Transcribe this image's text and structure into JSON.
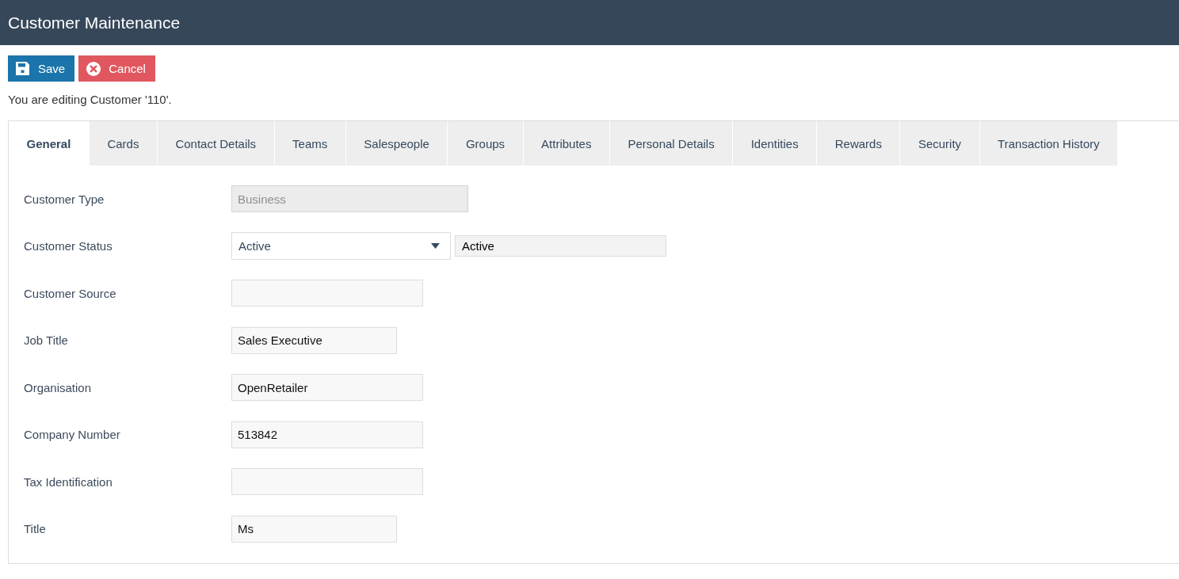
{
  "header": {
    "title": "Customer Maintenance"
  },
  "toolbar": {
    "buttons": [
      {
        "kind": "save",
        "label": "Save"
      },
      {
        "kind": "cancel",
        "label": "Cancel"
      }
    ]
  },
  "status_message": "You are editing Customer '110'.",
  "tabs": [
    {
      "label": "General",
      "selected": true
    },
    {
      "label": "Cards",
      "selected": false
    },
    {
      "label": "Contact Details",
      "selected": false
    },
    {
      "label": "Teams",
      "selected": false
    },
    {
      "label": "Salespeople",
      "selected": false
    },
    {
      "label": "Groups",
      "selected": false
    },
    {
      "label": "Attributes",
      "selected": false
    },
    {
      "label": "Personal Details",
      "selected": false
    },
    {
      "label": "Identities",
      "selected": false
    },
    {
      "label": "Rewards",
      "selected": false
    },
    {
      "label": "Security",
      "selected": false
    },
    {
      "label": "Transaction History",
      "selected": false
    }
  ],
  "form": {
    "fields": [
      {
        "kind": "text",
        "label": "Customer Type",
        "value": "Business",
        "disabled": true
      },
      {
        "kind": "select",
        "label": "Customer Status",
        "value": "Active",
        "display_value": "Active",
        "disabled": false
      },
      {
        "kind": "text",
        "label": "Customer Source",
        "disabled": false
      },
      {
        "kind": "text",
        "label": "Job Title",
        "value": "Sales Executive",
        "disabled": false
      },
      {
        "kind": "text",
        "label": "Organisation",
        "value": "OpenRetailer",
        "disabled": false
      },
      {
        "kind": "text",
        "label": "Company Number",
        "value": "513842",
        "disabled": false
      },
      {
        "kind": "text",
        "label": "Tax Identification",
        "disabled": false
      },
      {
        "kind": "text",
        "label": "Title",
        "value": "Ms",
        "disabled": false
      }
    ]
  }
}
